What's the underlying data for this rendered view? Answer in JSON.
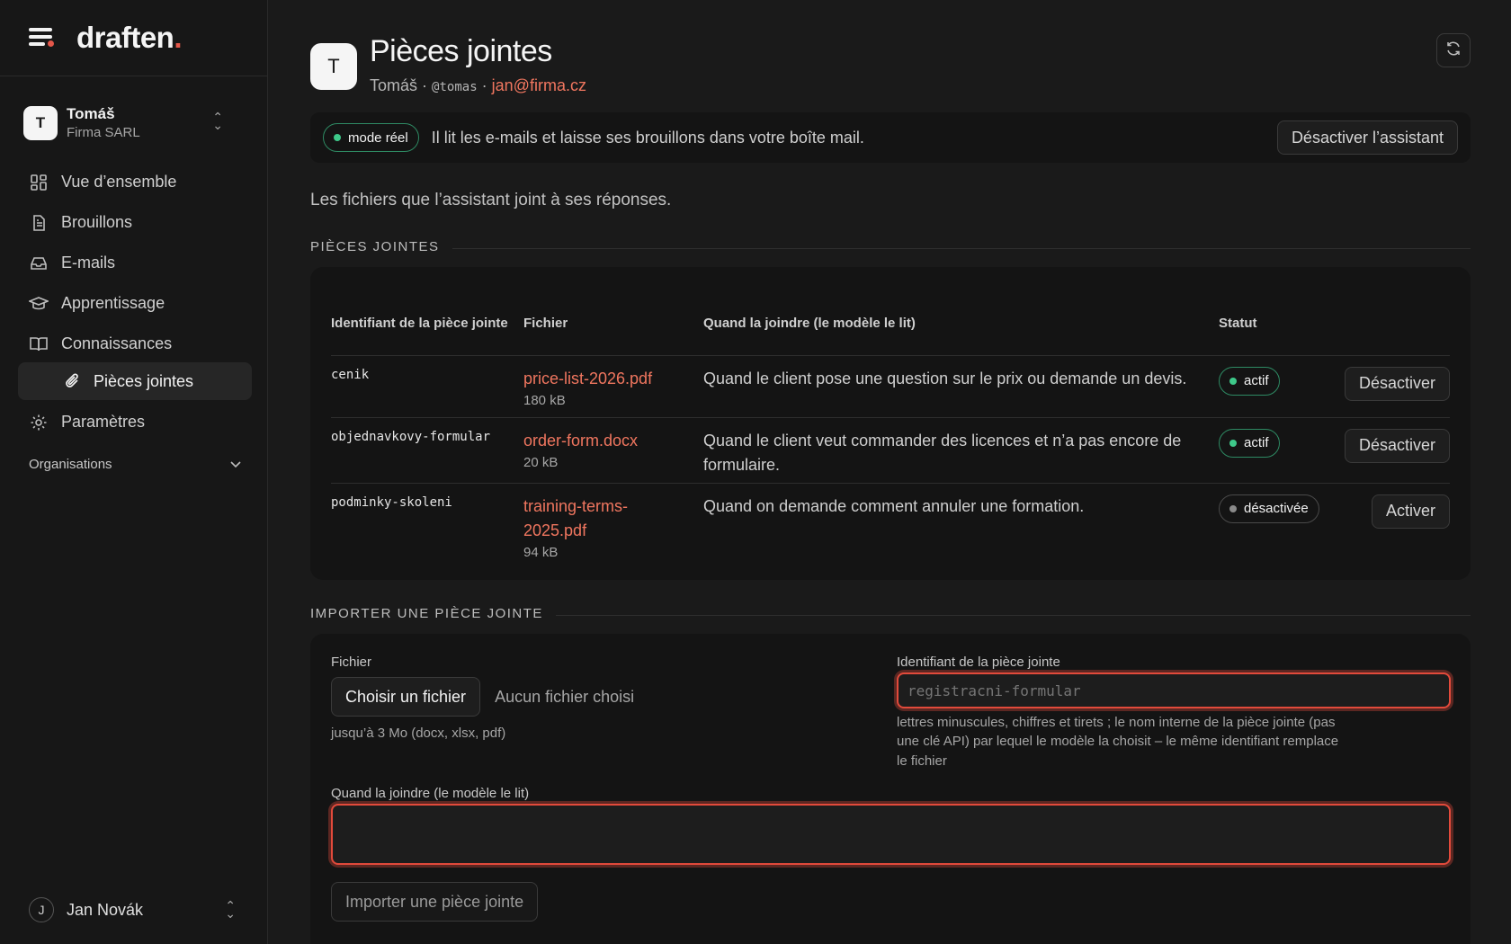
{
  "brand": {
    "name": "draften",
    "dot": "."
  },
  "account": {
    "initial": "T",
    "name": "Tomáš",
    "org": "Firma SARL"
  },
  "nav": {
    "items": [
      {
        "label": "Vue d’ensemble",
        "icon": "grid-icon"
      },
      {
        "label": "Brouillons",
        "icon": "document-icon"
      },
      {
        "label": "E-mails",
        "icon": "inbox-icon"
      },
      {
        "label": "Apprentissage",
        "icon": "graduation-cap-icon"
      },
      {
        "label": "Connaissances",
        "icon": "book-icon"
      }
    ],
    "sub_item": {
      "label": "Pièces jointes",
      "icon": "paperclip-icon"
    },
    "settings": {
      "label": "Paramètres",
      "icon": "gear-icon"
    },
    "organisations_label": "Organisations"
  },
  "user": {
    "initial": "J",
    "name": "Jan Novák"
  },
  "header": {
    "initial": "T",
    "title": "Pièces jointes",
    "sub_name": "Tomáš",
    "sep": "·",
    "handle": "@tomas",
    "email": "jan@firma.cz"
  },
  "banner": {
    "mode_label": "mode réel",
    "text": "Il lit les e-mails et laisse ses brouillons dans votre boîte mail.",
    "deactivate_label": "Désactiver l’assistant"
  },
  "description": "Les fichiers que l’assistant joint à ses réponses.",
  "attachments_section": "PIÈCES JOINTES",
  "table": {
    "headers": {
      "id": "Identifiant de la pièce jointe",
      "file": "Fichier",
      "when": "Quand la joindre (le modèle le lit)",
      "status": "Statut"
    },
    "rows": [
      {
        "id": "cenik",
        "file": "price-list-2026.pdf",
        "size": "180 kB",
        "when": "Quand le client pose une question sur le prix ou demande un devis.",
        "status": "actif",
        "action": "Désactiver"
      },
      {
        "id": "objednavkovy-formular",
        "file": "order-form.docx",
        "size": "20 kB",
        "when": "Quand le client veut commander des licences et n’a pas encore de formulaire.",
        "status": "actif",
        "action": "Désactiver"
      },
      {
        "id": "podminky-skoleni",
        "file": "training-terms-2025.pdf",
        "size": "94 kB",
        "when": "Quand on demande comment annuler une formation.",
        "status": "désactivée",
        "action": "Activer"
      }
    ]
  },
  "import_section": "IMPORTER UNE PIÈCE JOINTE",
  "import": {
    "file_label": "Fichier",
    "choose_label": "Choisir un fichier",
    "no_file": "Aucun fichier choisi",
    "file_hint": "jusqu’à 3 Mo (docx, xlsx, pdf)",
    "id_label": "Identifiant de la pièce jointe",
    "id_placeholder": "registracni-formular",
    "id_hint": "lettres minuscules, chiffres et tirets ; le nom interne de la pièce jointe (pas une clé API) par lequel le modèle la choisit – le même identifiant remplace le fichier",
    "when_label": "Quand la joindre (le modèle le lit)",
    "submit_label": "Importer une pièce jointe"
  },
  "colors": {
    "accent": "#f0765f",
    "active": "#3ec98a",
    "error": "#e24a3b"
  }
}
